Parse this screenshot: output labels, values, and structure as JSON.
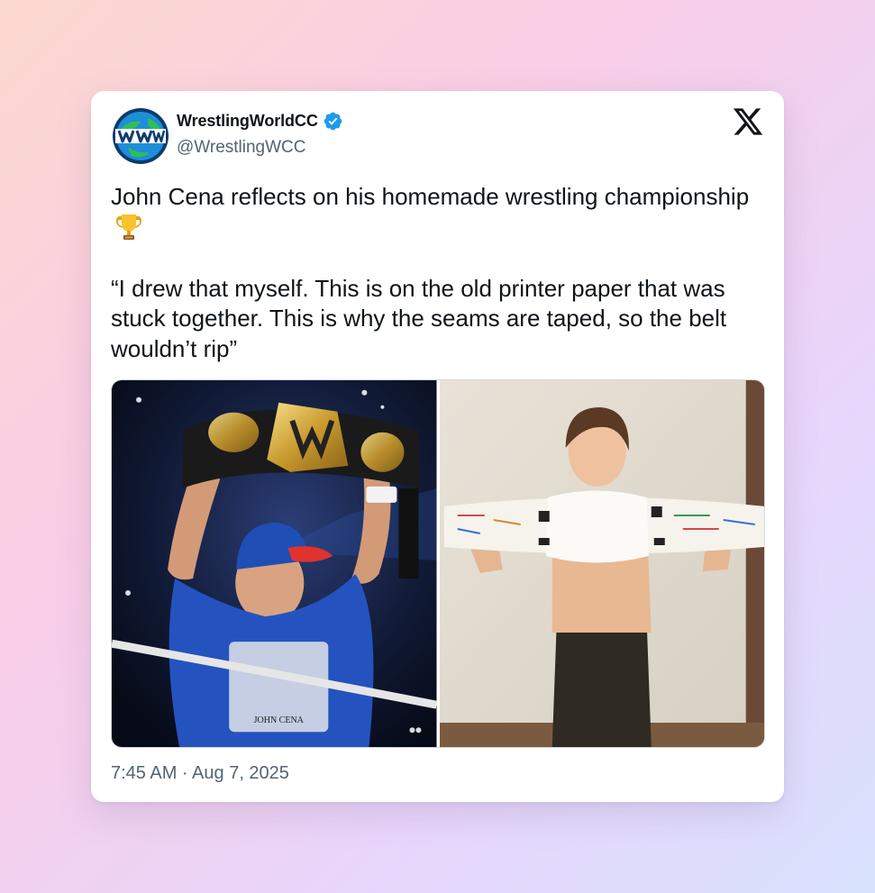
{
  "author": {
    "display_name": "WrestlingWorldCC",
    "handle": "@WrestlingWCC",
    "verified": true,
    "avatar_icon": "globe-ww-logo-icon"
  },
  "tweet": {
    "text": "John Cena reflects on his homemade wrestling championship",
    "emoji_icon": "trophy-icon",
    "quote": "“I drew that myself. This is on the old printer paper that was stuck together. This is why the seams are taped, so the belt wouldn’t rip”"
  },
  "media": [
    {
      "name": "photo-wrestler-holding-title-belt"
    },
    {
      "name": "photo-child-holding-paper-belt"
    }
  ],
  "timestamp": "7:45 AM · Aug 7, 2025",
  "colors": {
    "verified": "#1d9bf0",
    "text_primary": "#0f1419",
    "text_secondary": "#536471"
  }
}
